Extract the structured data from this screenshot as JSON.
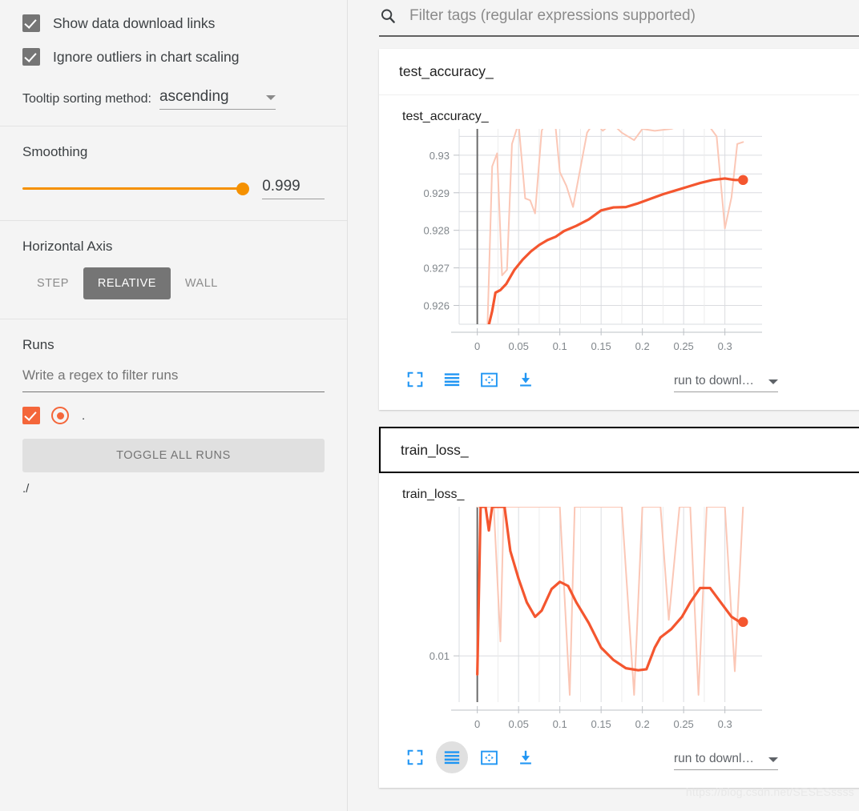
{
  "sidebar": {
    "checkboxes": [
      {
        "label": "Show data download links",
        "checked": true
      },
      {
        "label": "Ignore outliers in chart scaling",
        "checked": true
      }
    ],
    "tooltip": {
      "label": "Tooltip sorting method:",
      "value": "ascending",
      "caret_icon": "chevron-down-icon"
    },
    "smoothing": {
      "title": "Smoothing",
      "value": "0.999",
      "fill_percent": 100,
      "accent": "#f59100"
    },
    "horizontal_axis": {
      "title": "Horizontal Axis",
      "options": [
        "STEP",
        "RELATIVE",
        "WALL"
      ],
      "selected": "RELATIVE"
    },
    "runs": {
      "title": "Runs",
      "filter_placeholder": "Write a regex to filter runs",
      "run_items": [
        {
          "label": ".",
          "checked": true,
          "color": "#f4663a",
          "marker_icon": "radio-filled-icon"
        }
      ],
      "toggle_all_label": "TOGGLE ALL RUNS",
      "run_path": "./"
    }
  },
  "main": {
    "filter": {
      "icon": "search-icon",
      "placeholder": "Filter tags (regular expressions supported)"
    },
    "cards": [
      {
        "header": "test_accuracy_",
        "focused": false,
        "chart_title": "test_accuracy_",
        "toolbar_icons": [
          {
            "name": "fullscreen-icon",
            "active": false
          },
          {
            "name": "data-series-icon",
            "active": false
          },
          {
            "name": "fit-domain-icon",
            "active": false
          },
          {
            "name": "download-icon",
            "active": false
          }
        ],
        "download_select": {
          "text": "run to downl…",
          "caret_icon": "chevron-down-icon"
        }
      },
      {
        "header": "train_loss_",
        "focused": true,
        "chart_title": "train_loss_",
        "toolbar_icons": [
          {
            "name": "fullscreen-icon",
            "active": false
          },
          {
            "name": "data-series-icon",
            "active": true
          },
          {
            "name": "fit-domain-icon",
            "active": false
          },
          {
            "name": "download-icon",
            "active": false
          }
        ],
        "download_select": {
          "text": "run to downl…",
          "caret_icon": "chevron-down-icon"
        }
      }
    ],
    "watermark": "https://blog.csdn.net/SESESssss"
  },
  "chart_data": [
    {
      "type": "line",
      "title": "test_accuracy_",
      "xlabel": "",
      "ylabel": "",
      "xticks": [
        0,
        0.05,
        0.1,
        0.15,
        0.2,
        0.25,
        0.3
      ],
      "xticklabels": [
        "0",
        "0.05",
        "0.1",
        "0.15",
        "0.2",
        "0.25",
        "0.3"
      ],
      "yticks": [
        0.926,
        0.927,
        0.928,
        0.929,
        0.93
      ],
      "yticklabels": [
        "0.926",
        "0.927",
        "0.928",
        "0.929",
        "0.93"
      ],
      "xlim": [
        -0.022,
        0.345
      ],
      "ylim": [
        0.9255,
        0.9307
      ],
      "grid": true,
      "legend": "none",
      "line_color": "#f4562f",
      "raw_color": "#fbc7b6",
      "series": [
        {
          "name": "smoothed",
          "x": [
            0.012,
            0.018,
            0.022,
            0.028,
            0.035,
            0.045,
            0.055,
            0.065,
            0.075,
            0.085,
            0.095,
            0.105,
            0.12,
            0.135,
            0.15,
            0.165,
            0.18,
            0.195,
            0.21,
            0.225,
            0.24,
            0.255,
            0.27,
            0.285,
            0.3,
            0.312,
            0.322
          ],
          "y": [
            0.9253,
            0.92585,
            0.92634,
            0.92641,
            0.92657,
            0.92695,
            0.92722,
            0.92744,
            0.92761,
            0.92774,
            0.92783,
            0.92798,
            0.92812,
            0.92829,
            0.92853,
            0.92861,
            0.92862,
            0.92872,
            0.92884,
            0.92896,
            0.92906,
            0.92916,
            0.92926,
            0.92934,
            0.92938,
            0.92934,
            0.92934
          ]
        },
        {
          "name": "raw",
          "x": [
            0.012,
            0.018,
            0.024,
            0.03,
            0.036,
            0.042,
            0.05,
            0.058,
            0.064,
            0.07,
            0.078,
            0.086,
            0.094,
            0.1,
            0.108,
            0.116,
            0.124,
            0.133,
            0.142,
            0.152,
            0.163,
            0.175,
            0.19,
            0.2,
            0.215,
            0.235,
            0.255,
            0.275,
            0.29,
            0.3,
            0.308,
            0.315,
            0.322
          ],
          "y": [
            0.9252,
            0.9297,
            0.93005,
            0.9268,
            0.92695,
            0.9303,
            0.93085,
            0.92885,
            0.9288,
            0.92845,
            0.93065,
            0.93105,
            0.93095,
            0.92955,
            0.92918,
            0.92862,
            0.92955,
            0.9306,
            0.9309,
            0.93065,
            0.93085,
            0.9306,
            0.9304,
            0.9307,
            0.93065,
            0.9307,
            0.93085,
            0.93095,
            0.9305,
            0.92805,
            0.92888,
            0.9303,
            0.93035
          ]
        }
      ],
      "last_point": {
        "x": 0.322,
        "y": 0.92934
      }
    },
    {
      "type": "line",
      "title": "train_loss_",
      "xlabel": "",
      "ylabel": "",
      "xticks": [
        0,
        0.05,
        0.1,
        0.15,
        0.2,
        0.25,
        0.3
      ],
      "xticklabels": [
        "0",
        "0.05",
        "0.1",
        "0.15",
        "0.2",
        "0.25",
        "0.3"
      ],
      "yticks": [
        0.01
      ],
      "yticklabels": [
        "0.01"
      ],
      "xlim": [
        -0.022,
        0.345
      ],
      "ylim": [
        0.0055,
        0.0245
      ],
      "grid": true,
      "legend": "none",
      "line_color": "#f4562f",
      "raw_color": "#fbc7b6",
      "series": [
        {
          "name": "smoothed",
          "x": [
            0.0,
            0.004,
            0.01,
            0.014,
            0.018,
            0.023,
            0.028,
            0.033,
            0.04,
            0.05,
            0.06,
            0.07,
            0.078,
            0.09,
            0.1,
            0.11,
            0.12,
            0.135,
            0.15,
            0.165,
            0.18,
            0.195,
            0.205,
            0.215,
            0.222,
            0.235,
            0.248,
            0.258,
            0.27,
            0.282,
            0.295,
            0.308,
            0.318,
            0.322
          ],
          "y": [
            0.0082,
            0.0245,
            0.0245,
            0.0222,
            0.0245,
            0.0245,
            0.0245,
            0.0245,
            0.0202,
            0.0175,
            0.0152,
            0.0138,
            0.0144,
            0.0165,
            0.0172,
            0.0168,
            0.0152,
            0.0132,
            0.0108,
            0.0096,
            0.0088,
            0.0086,
            0.0087,
            0.0108,
            0.0118,
            0.0126,
            0.0138,
            0.0152,
            0.0166,
            0.0166,
            0.0152,
            0.0138,
            0.0133,
            0.0133
          ]
        },
        {
          "name": "raw",
          "x": [
            0.0,
            0.006,
            0.012,
            0.02,
            0.028,
            0.032,
            0.038,
            0.05,
            0.062,
            0.075,
            0.088,
            0.1,
            0.112,
            0.118,
            0.13,
            0.145,
            0.16,
            0.175,
            0.19,
            0.2,
            0.207,
            0.215,
            0.222,
            0.232,
            0.245,
            0.258,
            0.268,
            0.278,
            0.29,
            0.3,
            0.312,
            0.322
          ],
          "y": [
            0.0245,
            0.0245,
            0.0245,
            0.0245,
            0.0114,
            0.0245,
            0.0245,
            0.0245,
            0.0245,
            0.0245,
            0.0245,
            0.0245,
            0.0062,
            0.0245,
            0.0245,
            0.0245,
            0.0245,
            0.0245,
            0.0062,
            0.0245,
            0.0245,
            0.0245,
            0.0245,
            0.0135,
            0.0245,
            0.0245,
            0.0062,
            0.0245,
            0.0245,
            0.0245,
            0.0085,
            0.0245
          ]
        }
      ],
      "last_point": {
        "x": 0.322,
        "y": 0.0133
      }
    }
  ]
}
